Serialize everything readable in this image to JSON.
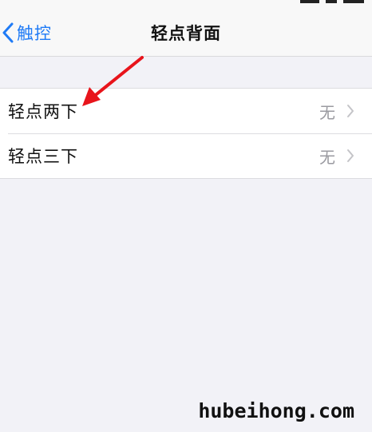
{
  "nav": {
    "back_label": "触控",
    "title": "轻点背面"
  },
  "items": [
    {
      "label": "轻点两下",
      "value": "无"
    },
    {
      "label": "轻点三下",
      "value": "无"
    }
  ],
  "watermark": "hubeihong.com",
  "colors": {
    "accent": "#1f7bf6",
    "annotation_arrow": "#e8141b",
    "background": "#f2f2f7"
  },
  "icons": {
    "back": "chevron-left-icon",
    "disclosure": "chevron-right-icon"
  }
}
